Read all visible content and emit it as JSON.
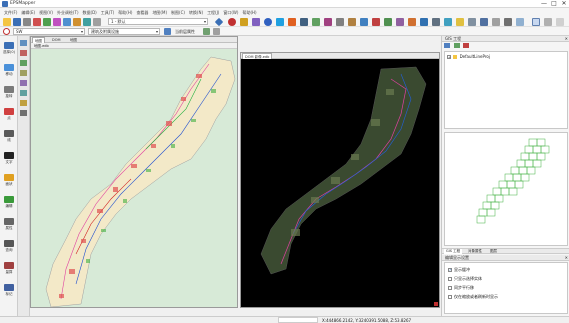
{
  "app": {
    "title": "EPSMapper"
  },
  "window": {
    "minimize": "—",
    "maximize": "□",
    "close": "✕"
  },
  "menu": [
    "文件(F)",
    "编辑(E)",
    "视图(V)",
    "外业调绘(T)",
    "数据(D)",
    "工具(T)",
    "帮助(H)",
    "查看器",
    "地图(M)",
    "制图(C)",
    "转换(N)",
    "工程(J)",
    "窗口(W)",
    "帮助(H)"
  ],
  "toolbar": {
    "layer_combo": "1 - 默认",
    "coord_combo": "SW",
    "style_combo": "建筑及附属设施",
    "status_text": "当前层属性"
  },
  "left_tools": [
    {
      "label": "选择(0)",
      "color": "#3b6fb6"
    },
    {
      "label": "移动",
      "color": "#4a90d9"
    },
    {
      "label": "旋转",
      "color": "#7a7a7a"
    },
    {
      "label": "点",
      "color": "#d04040"
    },
    {
      "label": "线",
      "color": "#5a5a5a"
    },
    {
      "label": "文字",
      "color": "#222222"
    },
    {
      "label": "面状",
      "color": "#e0a020"
    },
    {
      "label": "编辑",
      "color": "#3a9a3a"
    },
    {
      "label": "属性",
      "color": "#666666"
    },
    {
      "label": "查询",
      "color": "#555555"
    },
    {
      "label": "量算",
      "color": "#a04040"
    },
    {
      "label": "标记",
      "color": "#4060a0"
    }
  ],
  "map_left": {
    "tabs": [
      {
        "label": "地图",
        "active": true
      },
      {
        "label": "DOM",
        "active": false
      },
      {
        "label": "地图",
        "active": false
      }
    ],
    "title": "地图.edb"
  },
  "map_right": {
    "tab": "DOM 影像.edb"
  },
  "right_panel": {
    "title": "GIS 工程",
    "tree_root": "DefaultLineProj",
    "tabs": [
      "GIS 工程",
      "对象属性",
      "图层"
    ],
    "settings_title": "编辑显示设置",
    "settings": [
      {
        "label": "显示缓冲",
        "checked": true
      },
      {
        "label": "只显示选择实体",
        "checked": false
      },
      {
        "label": "同步平行移",
        "checked": false
      },
      {
        "label": "仅在缩放或者刷新时显示",
        "checked": false
      }
    ]
  },
  "status": {
    "coords": "X:444866.2142, Y:3240391.5088, Z:53.8267"
  },
  "colors": {
    "map_bg_left": "#d7ead7",
    "map_bg_right": "#000000",
    "overview_green": "#60c060"
  }
}
